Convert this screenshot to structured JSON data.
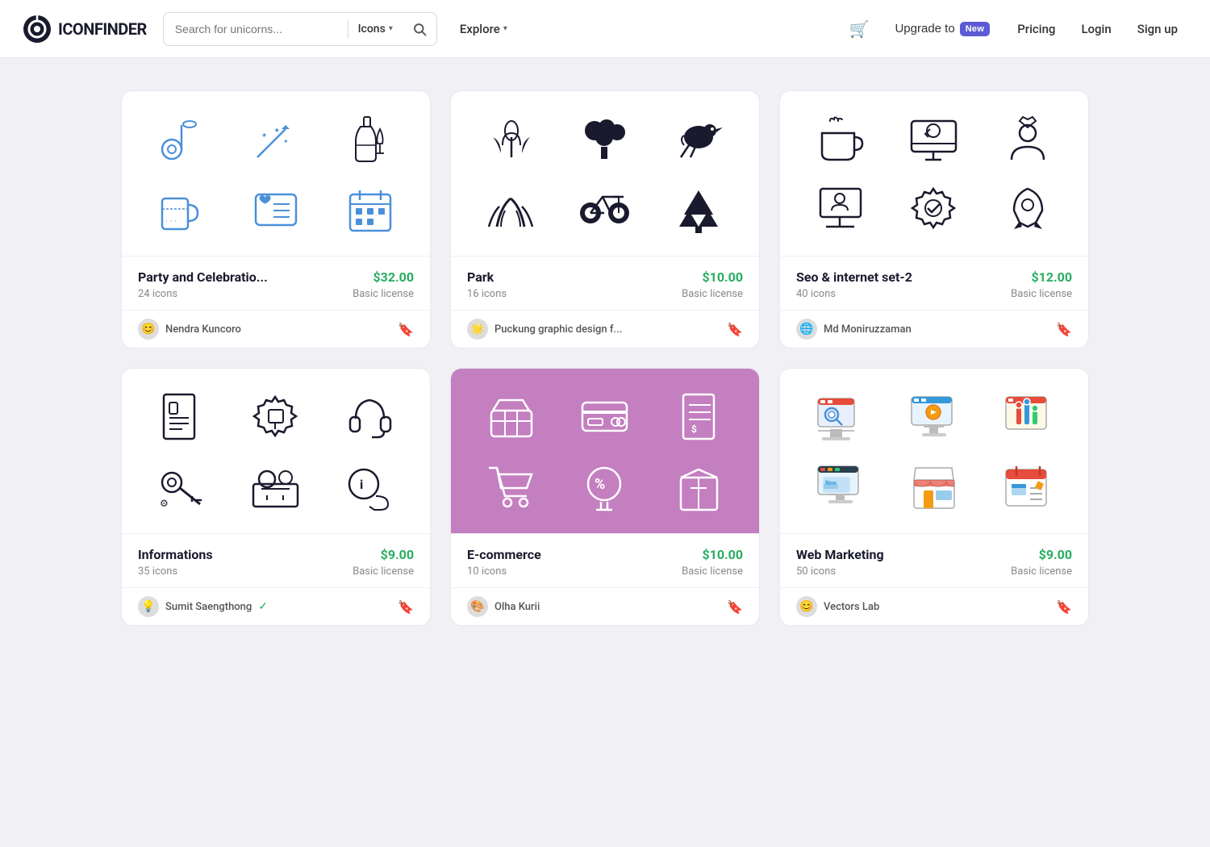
{
  "header": {
    "logo_text": "ICONFINDER",
    "search_placeholder": "Search for unicorns...",
    "search_type": "Icons",
    "explore_label": "Explore",
    "upgrade_label": "Upgrade to",
    "new_badge": "New",
    "pricing_label": "Pricing",
    "login_label": "Login",
    "signup_label": "Sign up"
  },
  "cards": [
    {
      "id": "party",
      "title": "Party and Celebratio...",
      "count": "24 icons",
      "price": "$32.00",
      "license": "Basic license",
      "author": "Nendra Kuncoro",
      "author_emoji": "😊",
      "bg": "white",
      "verified": false
    },
    {
      "id": "park",
      "title": "Park",
      "count": "16 icons",
      "price": "$10.00",
      "license": "Basic license",
      "author": "Puckung graphic design f...",
      "author_emoji": "🌟",
      "bg": "white",
      "verified": false
    },
    {
      "id": "seo",
      "title": "Seo & internet set-2",
      "count": "40 icons",
      "price": "$12.00",
      "license": "Basic license",
      "author": "Md Moniruzzaman",
      "author_emoji": "🌐",
      "bg": "white",
      "verified": false
    },
    {
      "id": "info",
      "title": "Informations",
      "count": "35 icons",
      "price": "$9.00",
      "license": "Basic license",
      "author": "Sumit Saengthong",
      "author_emoji": "💡",
      "bg": "white",
      "verified": true
    },
    {
      "id": "ecommerce",
      "title": "E-commerce",
      "count": "10 icons",
      "price": "$10.00",
      "license": "Basic license",
      "author": "Olha Kurii",
      "author_emoji": "🎨",
      "bg": "purple",
      "verified": false
    },
    {
      "id": "webmarketing",
      "title": "Web Marketing",
      "count": "50 icons",
      "price": "$9.00",
      "license": "Basic license",
      "author": "Vectors Lab",
      "author_emoji": "😊",
      "bg": "white",
      "verified": false
    }
  ]
}
